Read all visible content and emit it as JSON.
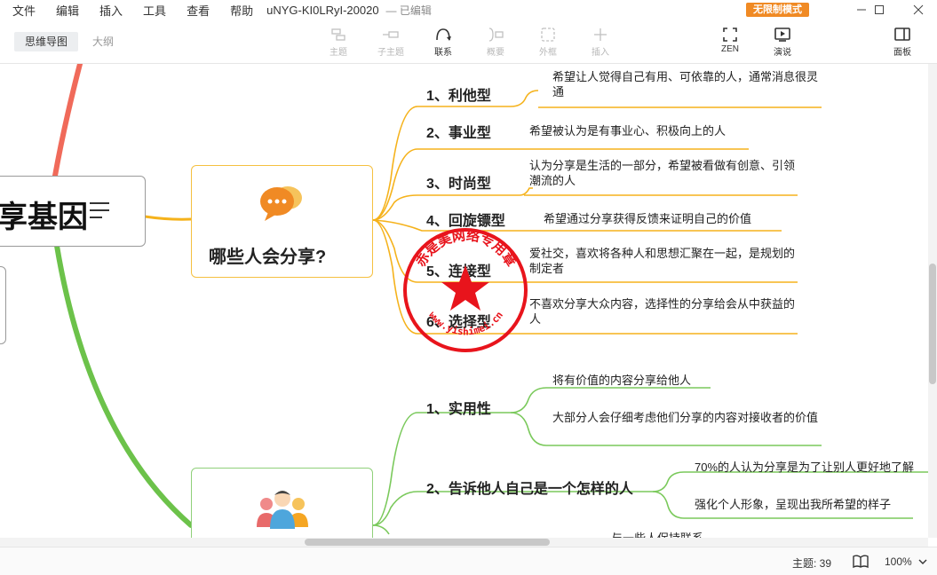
{
  "menu": {
    "items": [
      "文件",
      "编辑",
      "插入",
      "工具",
      "查看",
      "帮助"
    ],
    "doc_title": "uNYG-KI0LRyI-20020",
    "doc_status": "— 已编辑",
    "mode_badge": "无限制模式"
  },
  "toolbar": {
    "view_tabs": [
      "思维导图",
      "大纲"
    ],
    "tools": [
      "主题",
      "子主题",
      "联系",
      "概要",
      "外框",
      "插入"
    ],
    "zen_label": "ZEN",
    "present_label": "演说",
    "panel_label": "面板"
  },
  "mindmap": {
    "root_partial": "享基因",
    "branch1": {
      "title": "哪些人会分享?",
      "items": [
        {
          "topic": "1、利他型",
          "desc": "希望让人觉得自己有用、可依靠的人，通常消息很灵通"
        },
        {
          "topic": "2、事业型",
          "desc": "希望被认为是有事业心、积极向上的人"
        },
        {
          "topic": "3、时尚型",
          "desc": "认为分享是生活的一部分，希望被看做有创意、引领潮流的人"
        },
        {
          "topic": "4、回旋镖型",
          "desc": "希望通过分享获得反馈来证明自己的价值"
        },
        {
          "topic": "5、连接型",
          "desc": "爱社交，喜欢将各种人和思想汇聚在一起，是规划的制定者"
        },
        {
          "topic": "6、选择型",
          "desc": "不喜欢分享大众内容，选择性的分享给会从中获益的人"
        }
      ]
    },
    "branch2": {
      "items": [
        {
          "topic": "1、实用性",
          "descs": [
            "将有价值的内容分享给他人",
            "大部分人会仔细考虑他们分享的内容对接收者的价值"
          ]
        },
        {
          "topic": "2、告诉他人自己是一个怎样的人",
          "descs": [
            "70%的人认为分享是为了让别人更好地了解",
            "强化个人形象，呈现出我所希望的样子"
          ]
        }
      ],
      "partial_bottom": "与一些人保持联系"
    },
    "colors": {
      "branch_red": "#f06a5a",
      "branch_green": "#6cc24a",
      "orange_line": "#f5b21b",
      "green_line": "#7ac95b",
      "stamp_red": "#e8141c"
    }
  },
  "stamp": {
    "ring_text": "赤是美网络专用章",
    "url_text": "www.yishimei.cn"
  },
  "statusbar": {
    "topic_count": "主题: 39",
    "zoom": "100%"
  }
}
